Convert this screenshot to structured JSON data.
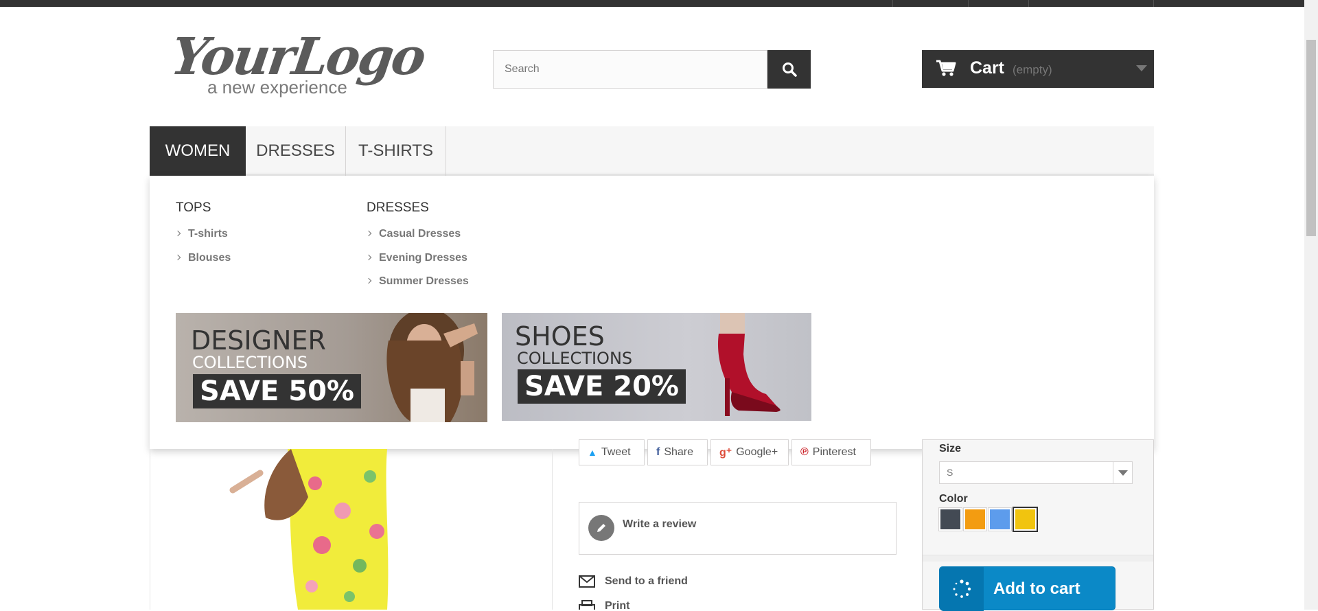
{
  "header": {
    "logo_main": "YourLogo",
    "logo_tagline": "a new experience",
    "search": {
      "placeholder": "Search"
    },
    "cart": {
      "label": "Cart",
      "status": "(empty)"
    }
  },
  "menu": {
    "items": [
      {
        "label": "WOMEN"
      },
      {
        "label": "DRESSES"
      },
      {
        "label": "T-SHIRTS"
      }
    ]
  },
  "dropdown": {
    "columns": [
      {
        "title": "TOPS",
        "links": [
          "T-shirts",
          "Blouses"
        ]
      },
      {
        "title": "DRESSES",
        "links": [
          "Casual Dresses",
          "Evening Dresses",
          "Summer Dresses"
        ]
      }
    ],
    "banners": [
      {
        "line1": "DESIGNER",
        "line2": "COLLECTIONS",
        "line3": "SAVE 50%"
      },
      {
        "line1": "SHOES",
        "line2": "COLLECTIONS",
        "line3": "SAVE 20%"
      }
    ]
  },
  "product": {
    "social": [
      "Tweet",
      "Share",
      "Google+",
      "Pinterest"
    ],
    "write_review": "Write a review",
    "send_friend": "Send to a friend",
    "print": "Print",
    "size_label": "Size",
    "size_value": "S",
    "color_label": "Color",
    "colors": [
      "#434a54",
      "#f39c11",
      "#5d9cec",
      "#f1c40f"
    ],
    "add_to_cart": "Add to cart"
  }
}
